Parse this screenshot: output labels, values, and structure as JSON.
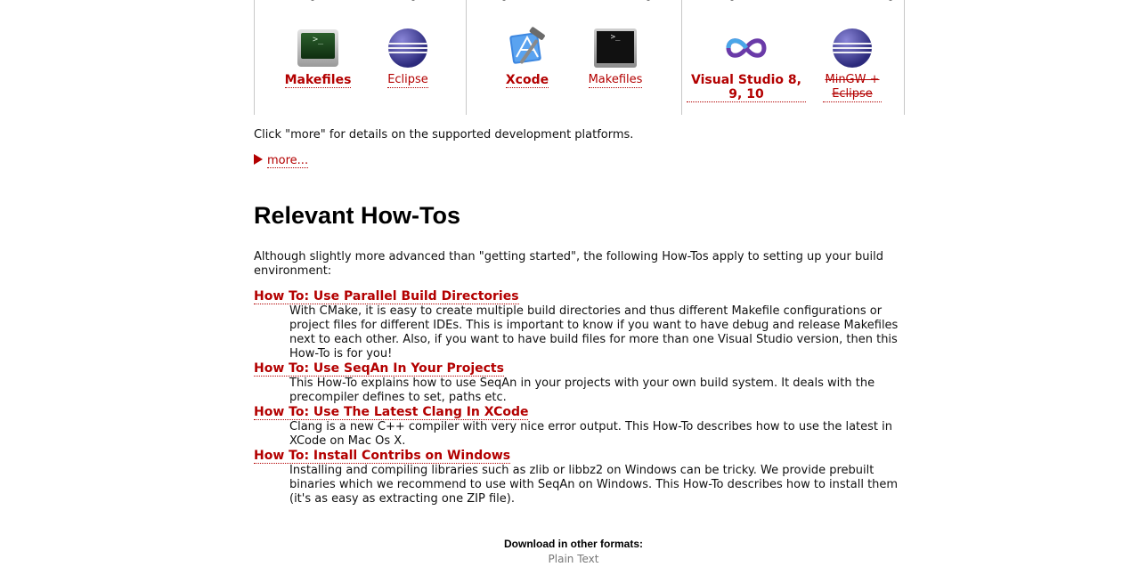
{
  "platforms": {
    "linux": {
      "tools": [
        {
          "label": "Makefiles",
          "icon": "terminal-green-icon",
          "bold": true
        },
        {
          "label": "Eclipse",
          "icon": "eclipse-icon",
          "bold": false
        }
      ]
    },
    "mac": {
      "tools": [
        {
          "label": "Xcode",
          "icon": "xcode-icon",
          "bold": true
        },
        {
          "label": "Makefiles",
          "icon": "terminal-black-icon",
          "bold": false
        }
      ]
    },
    "windows": {
      "tools": [
        {
          "label": "Visual Studio 8, 9, 10",
          "icon": "visual-studio-icon",
          "bold": true
        },
        {
          "label": "MinGW + Eclipse",
          "icon": "eclipse-icon",
          "bold": false,
          "struck": true
        }
      ]
    }
  },
  "intro_text": "Click \"more\" for details on the supported development platforms.",
  "more_link": "more...",
  "howtos": {
    "heading": "Relevant How-Tos",
    "lead": "Although slightly more advanced than \"getting started\", the following How-Tos apply to setting up your build environment:",
    "items": [
      {
        "title": "How To: Use Parallel Build Directories",
        "description": "With CMake, it is easy to create multiple build directories and thus different Makefile configurations or project files for different IDEs. This is important to know if you want to have debug and release Makefiles next to each other. Also, if you want to have build files for more than one Visual Studio version, then this How-To is for you!"
      },
      {
        "title": "How To: Use SeqAn In Your Projects",
        "description": "This How-To explains how to use SeqAn in your projects with your own build system. It deals with the precompiler defines to set, paths etc."
      },
      {
        "title": "How To: Use The Latest Clang In XCode",
        "description": "Clang is a new C++ compiler with very nice error output. This How-To describes how to use the latest in XCode on Mac Os X."
      },
      {
        "title": "How To: Install Contribs on Windows",
        "description": "Installing and compiling libraries such as zlib or libbz2 on Windows can be tricky. We provide prebuilt binaries which we recommend to use with SeqAn on Windows. This How-To describes how to install them (it's as easy as extracting one ZIP file)."
      }
    ]
  },
  "formats": {
    "heading": "Download in other formats:",
    "plain_text": "Plain Text"
  },
  "colors": {
    "link": "#b30000",
    "border": "#c8c8c8",
    "muted_link": "#777777"
  }
}
